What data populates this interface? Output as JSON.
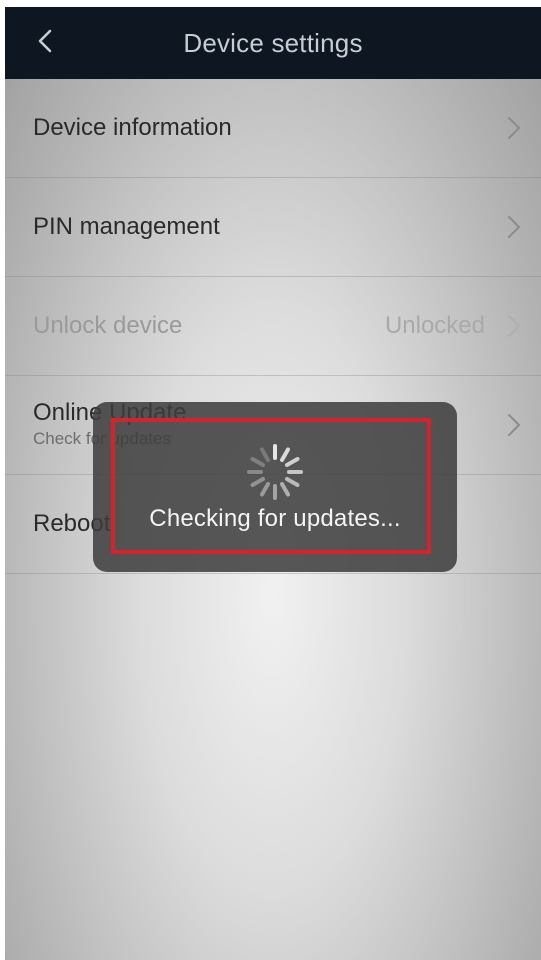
{
  "header": {
    "title": "Device settings",
    "back_icon": "chevron-left-icon"
  },
  "list": {
    "items": [
      {
        "label": "Device information",
        "value": ""
      },
      {
        "label": "PIN management",
        "value": ""
      },
      {
        "label": "Unlock device",
        "value": "Unlocked"
      },
      {
        "label": "Online Update",
        "sublabel": "Check for updates",
        "value": ""
      },
      {
        "label": "Reboot",
        "value": ""
      }
    ]
  },
  "toast": {
    "message": "Checking for updates...",
    "icon": "spinner-icon",
    "highlight_color": "#d3232f"
  },
  "colors": {
    "navbar": "#0d1621",
    "overlay": "#3c3c3c"
  }
}
